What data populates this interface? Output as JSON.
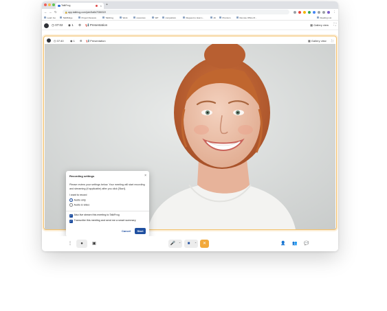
{
  "browser": {
    "tab_title": "TalkFrog",
    "new_tab": "+",
    "url": "app.talkfrog.com/join/5a8d7f38032f",
    "bookmarks": [
      "Learn Go",
      "TalkBridge",
      "Project Reviews",
      "TalkFrog",
      "Work",
      "resources",
      "WP",
      "competitors",
      "Request to Host L...",
      "All",
      "Premium",
      "Remote Office M...",
      "Reading List"
    ]
  },
  "header": {
    "timer": "07:02",
    "participants": "1",
    "presentation_label": "Presentation",
    "gallery_view_label": "Gallery view"
  },
  "inner_header": {
    "timer": "07:40",
    "participants": "1",
    "presentation_label": "Presentation",
    "gallery_view_label": "Gallery view"
  },
  "recording_modal": {
    "title": "Recording settings",
    "description": "Please review your settings below. Your meeting will start recording and streaming (if applicable) after you click [Start].",
    "i_want_label": "I want to record",
    "options": [
      {
        "label": "Audio only",
        "selected": true
      },
      {
        "label": "Audio & video",
        "selected": false
      }
    ],
    "checkboxes": [
      {
        "label": "Also live stream this meeting to TalkFrog",
        "checked": true
      },
      {
        "label": "Transcribe this meeting and send me a smart summary",
        "checked": true
      }
    ],
    "cancel_label": "Cancel",
    "start_label": "Start"
  },
  "colors": {
    "accent": "#1f4fa0",
    "highlight_border": "#f2c06b",
    "leave_button": "#f2a93b"
  },
  "icons": [
    "more-icon",
    "record-icon",
    "screen-share-icon",
    "microphone-icon",
    "camera-icon",
    "leave-icon",
    "add-person-icon",
    "participants-icon",
    "chat-icon"
  ]
}
